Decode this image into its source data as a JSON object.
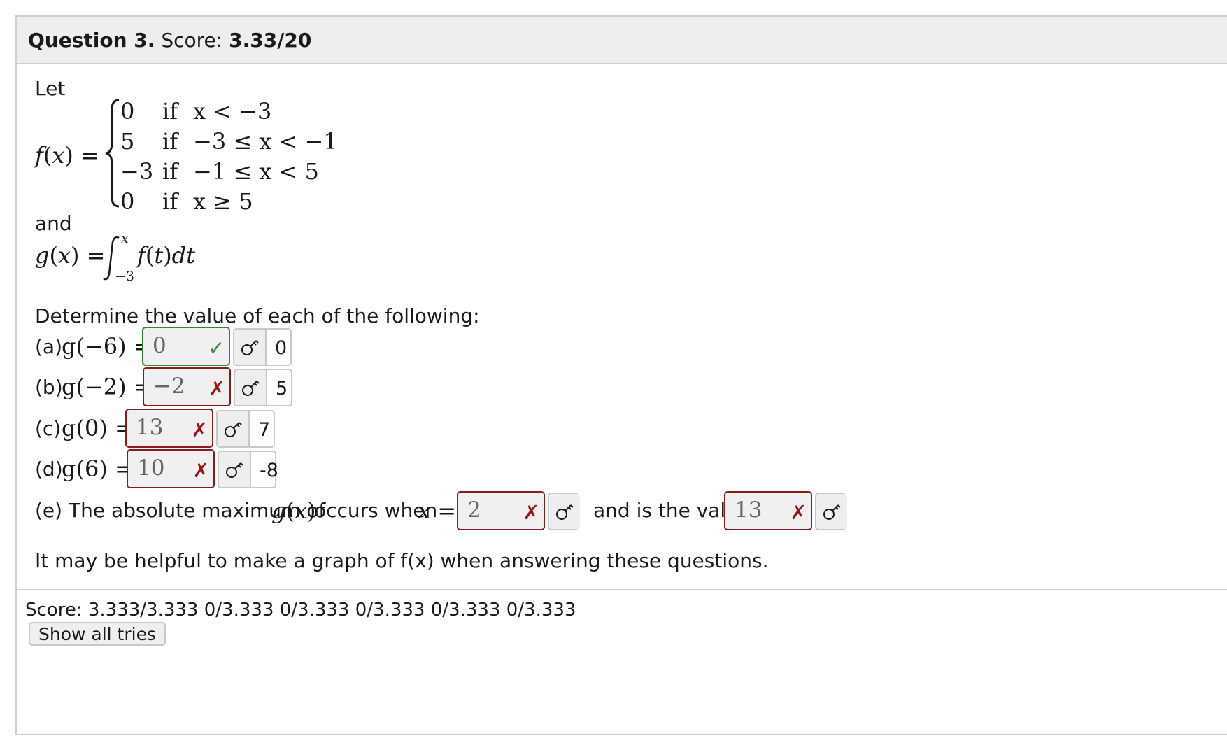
{
  "question": {
    "label": "Question 3.",
    "score_label": "Score:",
    "score": "3.33/20"
  },
  "intro": {
    "let": "Let",
    "and": "and"
  },
  "f_def": {
    "lhs": "f(x) =",
    "cases": [
      {
        "value": "0",
        "cond_word": "if",
        "cond": "x < −3"
      },
      {
        "value": "5",
        "cond_word": "if",
        "cond": "−3 ≤ x < −1"
      },
      {
        "value": "−3",
        "cond_word": "if",
        "cond": "−1 ≤ x < 5"
      },
      {
        "value": "0",
        "cond_word": "if",
        "cond": "x ≥ 5"
      }
    ]
  },
  "g_def": {
    "lhs": "g(x) =",
    "upper": "x",
    "lower": "−3",
    "integrand": "f(t)dt"
  },
  "prompt": "Determine the value of each of the following:",
  "parts": [
    {
      "label": "(a)",
      "expr": "g(−6) =",
      "answer": "0",
      "status": "correct",
      "key": "0"
    },
    {
      "label": "(b)",
      "expr": "g(−2) =",
      "answer": "−2",
      "status": "incorrect",
      "key": "5"
    },
    {
      "label": "(c)",
      "expr": "g(0) =",
      "answer": "13",
      "status": "incorrect",
      "key": "7"
    },
    {
      "label": "(d)",
      "expr": "g(6) =",
      "answer": "10",
      "status": "incorrect",
      "key": "-8"
    }
  ],
  "part_e": {
    "label": "(e) The absolute maximum of",
    "gx": "g(x)",
    "occurs": "occurs when",
    "xeq": "x =",
    "answer1": "2",
    "middle": "and is the value",
    "answer2": "13"
  },
  "hint": "It may be helpful to make a graph of f(x) when answering these questions.",
  "footer": {
    "score_line": "Score: 3.333/3.333 0/3.333 0/3.333 0/3.333 0/3.333 0/3.333",
    "show_tries": "Show all tries"
  },
  "marks": {
    "correct": "✓",
    "incorrect": "✗"
  },
  "colors": {
    "correct": "#2d8a2d",
    "incorrect": "#8b1a1a",
    "header_bg": "#eeeeee"
  },
  "icons": {
    "key": "key-icon"
  }
}
